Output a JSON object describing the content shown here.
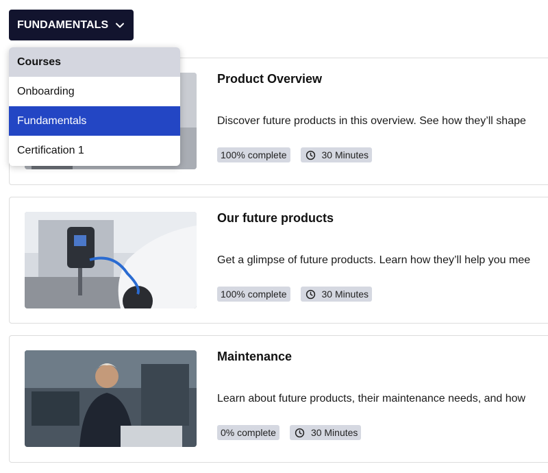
{
  "selector": {
    "label": "FUNDAMENTALS"
  },
  "dropdown": {
    "header": "Courses",
    "options": [
      {
        "label": "Onboarding",
        "selected": false
      },
      {
        "label": "Fundamentals",
        "selected": true
      },
      {
        "label": "Certification 1",
        "selected": false
      }
    ]
  },
  "cards": [
    {
      "title": "Product Overview",
      "description": "Discover future products in this overview. See how they’ll shape",
      "progress": "100% complete",
      "duration": "30 Minutes",
      "image": "product-overview-image"
    },
    {
      "title": "Our future products",
      "description": "Get a glimpse of future products. Learn how they’ll help you mee",
      "progress": "100% complete",
      "duration": "30 Minutes",
      "image": "ev-charging-image"
    },
    {
      "title": "Maintenance",
      "description": "Learn about future products, their maintenance needs, and how",
      "progress": "0% complete",
      "duration": "30 Minutes",
      "image": "technician-image"
    }
  ],
  "colors": {
    "selector_bg": "#12142e",
    "selected_option": "#2346c4",
    "tag_bg": "#d5d8e1",
    "dropdown_header_bg": "#d4d6df"
  },
  "icons": {
    "selector": "chevron-down-icon",
    "duration": "clock-icon"
  }
}
